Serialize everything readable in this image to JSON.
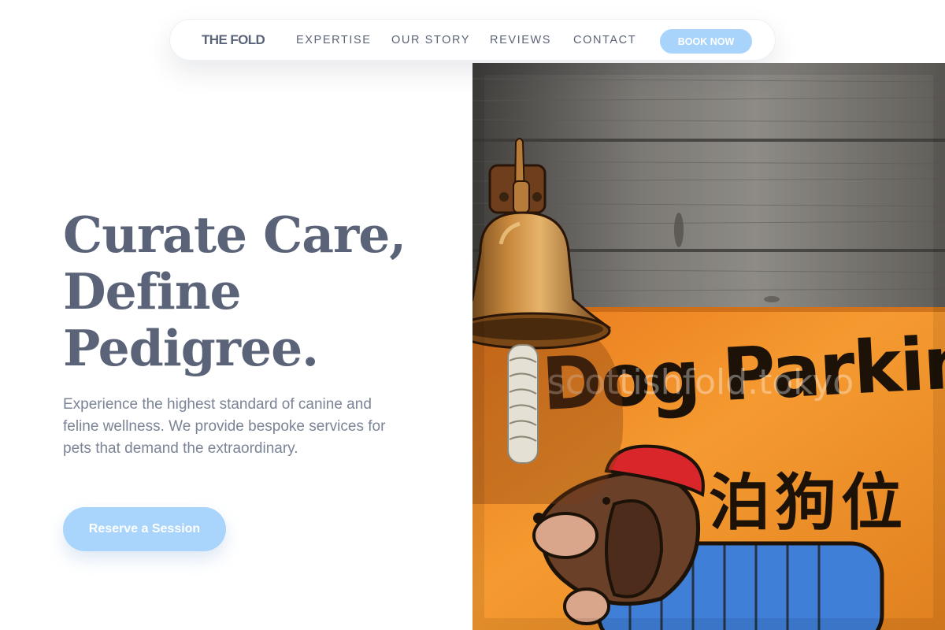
{
  "nav": {
    "brand": "THE FOLD",
    "links": [
      "EXPERTISE",
      "OUR STORY",
      "REVIEWS",
      "CONTACT"
    ],
    "book_button": "BOOK NOW"
  },
  "hero": {
    "headline_lines": [
      "Curate Care,",
      "Define",
      "Pedigree."
    ],
    "subtext": "Experience the highest standard of canine and feline wellness. We provide bespoke services for pets that demand the extraordinary.",
    "cta_label": "Reserve a Session"
  },
  "image": {
    "sign_text": "Dog Parking",
    "sign_kanji": "泊狗位",
    "watermark": "scottishfold.tokyo"
  },
  "colors": {
    "accent": "#a9d4fb",
    "heading": "#5a6378",
    "body_text": "#7b8496",
    "sign_orange": "#f0922a"
  }
}
